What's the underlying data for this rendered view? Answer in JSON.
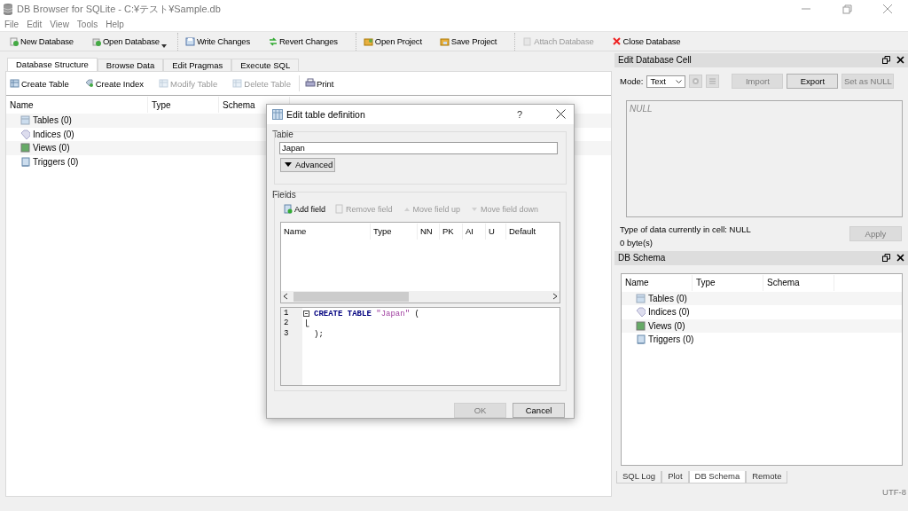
{
  "window": {
    "title": "DB Browser for SQLite - C:¥テスト¥Sample.db"
  },
  "menu": [
    "File",
    "Edit",
    "View",
    "Tools",
    "Help"
  ],
  "toolbar": [
    [
      {
        "label": "New Database",
        "disabled": false
      },
      {
        "label": "Open Database",
        "disabled": false,
        "dropdown": true
      }
    ],
    [
      {
        "label": "Write Changes",
        "disabled": false
      },
      {
        "label": "Revert Changes",
        "disabled": false
      }
    ],
    [
      {
        "label": "Open Project",
        "disabled": false
      },
      {
        "label": "Save Project",
        "disabled": false
      }
    ],
    [
      {
        "label": "Attach Database",
        "disabled": true
      },
      {
        "label": "Close Database",
        "disabled": false
      }
    ]
  ],
  "main_tabs": [
    {
      "label": "Database Structure",
      "selected": true
    },
    {
      "label": "Browse Data",
      "selected": false
    },
    {
      "label": "Edit Pragmas",
      "selected": false
    },
    {
      "label": "Execute SQL",
      "selected": false
    }
  ],
  "structure_toolbar": [
    [
      {
        "label": "Create Table",
        "disabled": false
      },
      {
        "label": "Create Index",
        "disabled": false
      },
      {
        "label": "Modify Table",
        "disabled": true
      },
      {
        "label": "Delete Table",
        "disabled": true
      }
    ],
    [
      {
        "label": "Print",
        "disabled": false
      }
    ]
  ],
  "structure_tree": {
    "columns": [
      "Name",
      "Type",
      "Schema"
    ],
    "items": [
      {
        "label": "Tables (0)",
        "kind": "tables"
      },
      {
        "label": "Indices (0)",
        "kind": "indices"
      },
      {
        "label": "Views (0)",
        "kind": "views"
      },
      {
        "label": "Triggers (0)",
        "kind": "triggers"
      }
    ]
  },
  "dialog": {
    "title": "Edit table definition",
    "help": "?",
    "table_group": "Table",
    "table_name": "Japan",
    "advanced": "Advanced",
    "fields_group": "Fields",
    "field_actions": [
      {
        "label": "Add field",
        "disabled": false
      },
      {
        "label": "Remove field",
        "disabled": true
      },
      {
        "label": "Move field up",
        "disabled": true
      },
      {
        "label": "Move field down",
        "disabled": true
      }
    ],
    "field_columns": [
      "Name",
      "Type",
      "NN",
      "PK",
      "AI",
      "U",
      "Default"
    ],
    "code_lines": [
      {
        "number": "1",
        "tokens": [
          {
            "text": "CREATE",
            "kind": "keyword"
          },
          {
            "text": "TABLE",
            "kind": "keyword"
          },
          {
            "text": "\"Japan\"",
            "kind": "string"
          },
          {
            "text": "(",
            "kind": "plain"
          }
        ]
      },
      {
        "number": "2"
      },
      {
        "number": "3",
        "tokens": [
          {
            "text": ");",
            "kind": "plain"
          }
        ]
      }
    ],
    "buttons": [
      {
        "label": "OK",
        "disabled": true
      },
      {
        "label": "Cancel",
        "disabled": false
      }
    ]
  },
  "edit_cell": {
    "title": "Edit Database Cell",
    "mode_label": "Mode:",
    "mode": "Text",
    "buttons": [
      {
        "label": "Import",
        "disabled": true
      },
      {
        "label": "Export",
        "disabled": false
      },
      {
        "label": "Set as NULL",
        "disabled": true
      }
    ],
    "value": "NULL",
    "type_info": "Type of data currently in cell: NULL",
    "size": "0 byte(s)",
    "apply": {
      "label": "Apply",
      "disabled": true
    }
  },
  "db_schema": {
    "title": "DB Schema",
    "columns": [
      "Name",
      "Type",
      "Schema"
    ],
    "items": [
      {
        "label": "Tables (0)",
        "kind": "tables"
      },
      {
        "label": "Indices (0)",
        "kind": "indices"
      },
      {
        "label": "Views (0)",
        "kind": "views"
      },
      {
        "label": "Triggers (0)",
        "kind": "triggers"
      }
    ]
  },
  "dock_tabs": [
    {
      "label": "SQL Log",
      "selected": false
    },
    {
      "label": "Plot",
      "selected": false
    },
    {
      "label": "DB Schema",
      "selected": true
    },
    {
      "label": "Remote",
      "selected": false
    }
  ],
  "status_bar": {
    "encoding": "UTF-8"
  }
}
